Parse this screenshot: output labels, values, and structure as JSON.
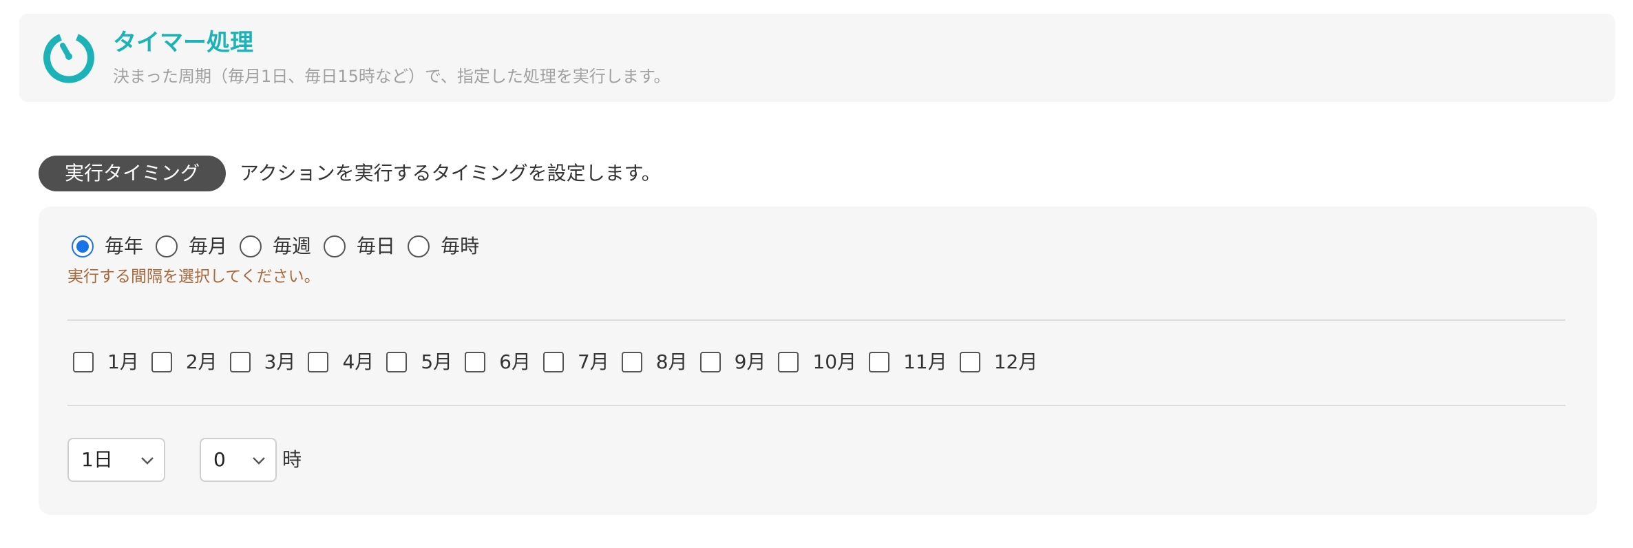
{
  "header": {
    "title": "タイマー処理",
    "description": "決まった周期（毎月1日、毎日15時など）で、指定した処理を実行します。",
    "icon": "timer-icon",
    "accent_color": "#1cb3b8"
  },
  "section": {
    "badge": "実行タイミング",
    "description": "アクションを実行するタイミングを設定します。"
  },
  "interval": {
    "options": [
      "毎年",
      "毎月",
      "毎週",
      "毎日",
      "毎時"
    ],
    "selected": "毎年",
    "hint": "実行する間隔を選択してください。"
  },
  "months": [
    "1月",
    "2月",
    "3月",
    "4月",
    "5月",
    "6月",
    "7月",
    "8月",
    "9月",
    "10月",
    "11月",
    "12月"
  ],
  "day_select": {
    "value": "1日"
  },
  "hour_select": {
    "value": "0",
    "unit": "時"
  }
}
